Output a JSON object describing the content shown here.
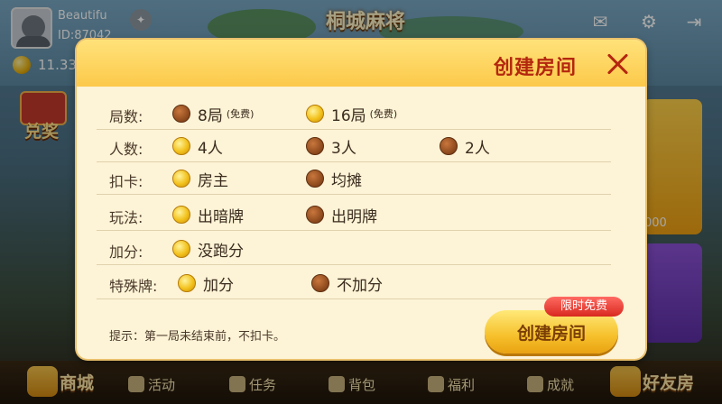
{
  "game": {
    "title": "桐城麻将"
  },
  "user": {
    "name": "Beautifu",
    "id": "ID:87042",
    "coins": "11.33"
  },
  "left_prize_label": "兑奖",
  "right_card_value": "000",
  "dialog": {
    "title": "创建房间",
    "rows": [
      {
        "label": "局数:",
        "options": [
          {
            "text": "8局",
            "sub": "(免费)",
            "selected": false
          },
          {
            "text": "16局",
            "sub": "(免费)",
            "selected": true
          }
        ]
      },
      {
        "label": "人数:",
        "options": [
          {
            "text": "4人",
            "selected": true
          },
          {
            "text": "3人",
            "selected": false
          },
          {
            "text": "2人",
            "selected": false
          }
        ]
      },
      {
        "label": "扣卡:",
        "options": [
          {
            "text": "房主",
            "selected": true
          },
          {
            "text": "均摊",
            "selected": false
          }
        ]
      },
      {
        "label": "玩法:",
        "options": [
          {
            "text": "出暗牌",
            "selected": true
          },
          {
            "text": "出明牌",
            "selected": false
          }
        ]
      },
      {
        "label": "加分:",
        "options": [
          {
            "text": "没跑分",
            "selected": true
          }
        ]
      },
      {
        "label": "特殊牌:",
        "options": [
          {
            "text": "加分",
            "selected": true
          },
          {
            "text": "不加分",
            "selected": false
          }
        ]
      }
    ],
    "hint": "提示：第一局未结束前，不扣卡。",
    "create_button": "创建房间",
    "free_tag": "限时免费"
  },
  "bottom_nav": {
    "shop": "商城",
    "activity": "活动",
    "task": "任务",
    "bag": "背包",
    "welfare": "福利",
    "achievement": "成就",
    "friend_room": "好友房"
  },
  "colors": {
    "dialog_bg": "#fdf3d6",
    "header": "#fcc94a",
    "title": "#b4270f"
  }
}
